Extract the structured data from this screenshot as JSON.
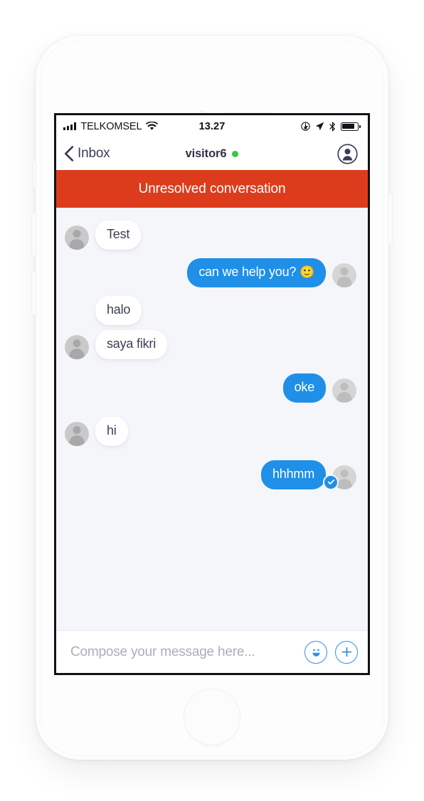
{
  "device": {
    "frame": "iphone-white",
    "home_button": "home-button"
  },
  "status_bar": {
    "carrier": "TELKOMSEL",
    "time": "13.27",
    "icons": [
      "signal-bars-icon",
      "wifi-icon",
      "alarm-rotation-lock-icon",
      "location-arrow-icon",
      "bluetooth-icon",
      "battery-icon"
    ],
    "battery_level": "82"
  },
  "nav_bar": {
    "back_label": "Inbox",
    "back_icon": "chevron-left-icon",
    "title": "visitor6",
    "online_status": "online",
    "online_color": "#36c93c",
    "profile_icon": "user-circle-icon"
  },
  "banner": {
    "text": "Unresolved conversation",
    "color": "#dd3c1c"
  },
  "chat": {
    "background": "#f5f6fa",
    "incoming_bubble_color": "#ffffff",
    "outgoing_bubble_color": "#1f8fe8",
    "messages": [
      {
        "text": "Test",
        "direction": "in",
        "avatar": true,
        "emoji": "",
        "receipt": false
      },
      {
        "text": "can we help you?",
        "direction": "out",
        "avatar": true,
        "emoji": "🙂",
        "receipt": false
      },
      {
        "text": "halo",
        "direction": "in",
        "avatar": false,
        "emoji": "",
        "receipt": false
      },
      {
        "text": "saya fikri",
        "direction": "in",
        "avatar": true,
        "emoji": "",
        "receipt": false
      },
      {
        "text": "oke",
        "direction": "out",
        "avatar": true,
        "emoji": "",
        "receipt": false
      },
      {
        "text": "hi",
        "direction": "in",
        "avatar": true,
        "emoji": "",
        "receipt": false
      },
      {
        "text": "hhhmm",
        "direction": "out",
        "avatar": true,
        "emoji": "",
        "receipt": true
      }
    ]
  },
  "compose": {
    "placeholder": "Compose your message here...",
    "value": "",
    "emoji_button": "smiley-face-icon",
    "attach_button": "plus-icon",
    "accent": "#2f8fe8"
  }
}
